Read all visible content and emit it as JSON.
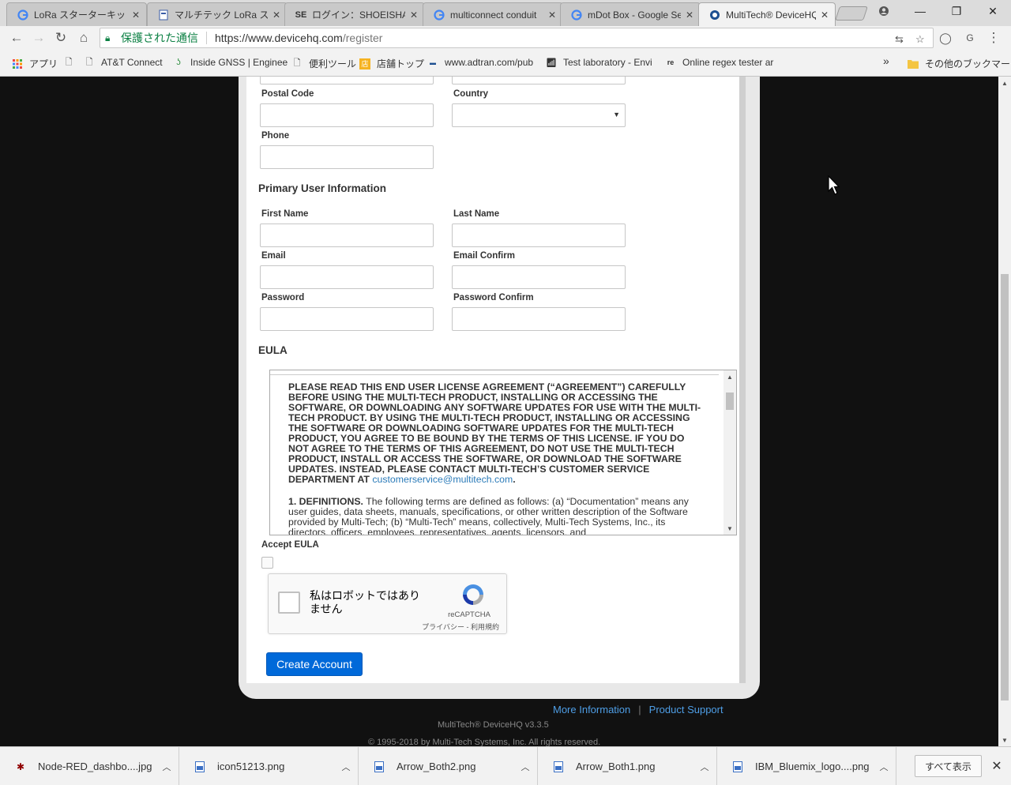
{
  "browser": {
    "tabs": [
      {
        "title": "LoRa スターターキット - G",
        "favicon": "google-icon",
        "active": false
      },
      {
        "title": "マルチテック LoRa スター",
        "favicon": "page-icon",
        "active": false
      },
      {
        "title": "ログイン：SHOEISHA iD",
        "favicon": "se-icon",
        "favicon_text": "SE",
        "active": false
      },
      {
        "title": "multiconnect conduit",
        "favicon": "google-icon",
        "active": false
      },
      {
        "title": "mDot Box - Google Se",
        "favicon": "google-icon",
        "active": false
      },
      {
        "title": "MultiTech® DeviceHQ",
        "favicon": "multitech-icon",
        "active": true
      }
    ],
    "security_label": "保護された通信",
    "url_host": "https://www.devicehq.com",
    "url_path": "/register",
    "bookmarks": [
      {
        "label": "アプリ",
        "icon": "apps-icon"
      },
      {
        "label": "",
        "icon": "page-icon"
      },
      {
        "label": "AT&T Connect",
        "icon": "page-icon"
      },
      {
        "label": "Inside GNSS | Enginee",
        "icon": "gnss-icon"
      },
      {
        "label": "便利ツール",
        "icon": "page-icon"
      },
      {
        "label": "店舗トップ",
        "icon": "store-icon"
      },
      {
        "label": "www.adtran.com/pub",
        "icon": "adtran-icon"
      },
      {
        "label": "Test laboratory - Envi",
        "icon": "wifi-icon"
      },
      {
        "label": "Online regex tester ar",
        "icon": "regex-icon"
      }
    ],
    "bookmarks_overflow": "»",
    "other_bookmarks": "その他のブックマーク"
  },
  "form": {
    "postal_code_label": "Postal Code",
    "country_label": "Country",
    "country_value": "",
    "phone_label": "Phone",
    "primary_user_heading": "Primary User Information",
    "first_name_label": "First Name",
    "last_name_label": "Last Name",
    "email_label": "Email",
    "email_confirm_label": "Email Confirm",
    "password_label": "Password",
    "password_confirm_label": "Password Confirm",
    "eula_heading": "EULA",
    "eula_paragraph1": "PLEASE READ THIS END USER LICENSE AGREEMENT (“AGREEMENT”) CAREFULLY BEFORE USING THE MULTI-TECH PRODUCT, INSTALLING OR ACCESSING THE SOFTWARE, OR DOWNLOADING ANY SOFTWARE UPDATES FOR USE WITH THE MULTI-TECH PRODUCT. BY USING THE MULTI-TECH PRODUCT, INSTALLING OR ACCESSING THE SOFTWARE OR DOWNLOADING SOFTWARE UPDATES FOR THE MULTI-TECH PRODUCT, YOU AGREE TO BE BOUND BY THE TERMS OF THIS LICENSE. IF YOU DO NOT AGREE TO THE TERMS OF THIS AGREEMENT, DO NOT USE THE MULTI-TECH PRODUCT, INSTALL OR ACCESS THE SOFTWARE, OR DOWNLOAD THE SOFTWARE UPDATES. INSTEAD, PLEASE CONTACT MULTI-TECH’S CUSTOMER SERVICE DEPARTMENT AT",
    "eula_email": "customerservice@multitech.com",
    "eula_def_heading": "1. DEFINITIONS.",
    "eula_def_text": "The following terms are defined as follows: (a) “Documentation” means any user guides, data sheets, manuals, specifications, or other written description of the Software provided by Multi-Tech; (b) “Multi-Tech” means, collectively, Multi-Tech Systems, Inc., its directors, officers, employees, representatives, agents, licensors, and",
    "accept_eula_label": "Accept EULA",
    "accept_eula_checked": false,
    "recaptcha_text": "私はロボットではありません",
    "recaptcha_brand": "reCAPTCHA",
    "recaptcha_links": "プライバシー - 利用規約",
    "create_button": "Create Account"
  },
  "footer": {
    "more_info": "More Information",
    "product_support": "Product Support",
    "separator": "|",
    "version": "MultiTech® DeviceHQ v3.3.5",
    "copyright": "© 1995-2018 by Multi-Tech Systems, Inc. All rights reserved."
  },
  "downloads": [
    {
      "name": "Node-RED_dashbo....jpg",
      "icon": "node-red-icon"
    },
    {
      "name": "icon51213.png",
      "icon": "image-file-icon"
    },
    {
      "name": "Arrow_Both2.png",
      "icon": "image-file-icon"
    },
    {
      "name": "Arrow_Both1.png",
      "icon": "image-file-icon"
    },
    {
      "name": "IBM_Bluemix_logo....png",
      "icon": "image-file-icon"
    }
  ],
  "show_all_label": "すべて表示",
  "colors": {
    "accent": "#0069d9",
    "link": "#4e9ee6",
    "secure": "#0b8043"
  }
}
